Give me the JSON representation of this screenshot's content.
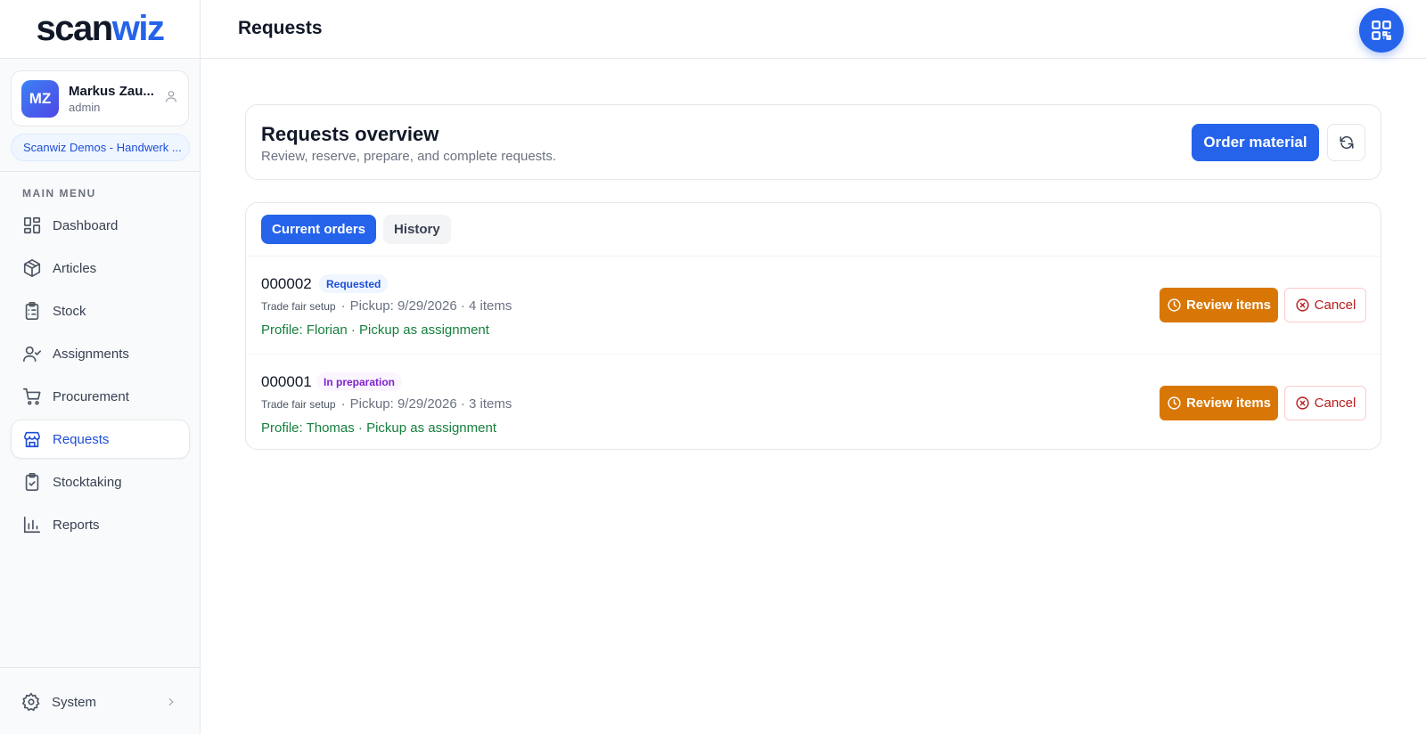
{
  "app": {
    "logo_scan": "scan",
    "logo_wiz": "wiz"
  },
  "user": {
    "initials": "MZ",
    "name": "Markus Zau...",
    "role": "admin",
    "organization": "Scanwiz Demos - Handwerk ..."
  },
  "sidebar": {
    "heading": "MAIN MENU",
    "items": [
      {
        "label": "Dashboard",
        "icon": "dashboard-icon"
      },
      {
        "label": "Articles",
        "icon": "package-icon"
      },
      {
        "label": "Stock",
        "icon": "clipboard-list-icon"
      },
      {
        "label": "Assignments",
        "icon": "user-check-icon"
      },
      {
        "label": "Procurement",
        "icon": "cart-icon"
      },
      {
        "label": "Requests",
        "icon": "store-icon",
        "active": true
      },
      {
        "label": "Stocktaking",
        "icon": "clipboard-check-icon"
      },
      {
        "label": "Reports",
        "icon": "bar-chart-icon"
      }
    ],
    "system_label": "System"
  },
  "header": {
    "title": "Requests"
  },
  "overview": {
    "title": "Requests overview",
    "subtitle": "Review, reserve, prepare, and complete requests.",
    "order_button": "Order material"
  },
  "tabs": [
    {
      "label": "Current orders",
      "active": true
    },
    {
      "label": "History",
      "active": false
    }
  ],
  "orders": [
    {
      "id": "000002",
      "status": "Requested",
      "tag": "Trade fair setup",
      "details": "Pickup: 9/29/2026 · 4 items",
      "profile": "Profile: Florian · Pickup as assignment",
      "review_label": "Review items",
      "cancel_label": "Cancel"
    },
    {
      "id": "000001",
      "status": "In preparation",
      "tag": "Trade fair setup",
      "details": "Pickup: 9/29/2026 · 3 items",
      "profile": "Profile: Thomas · Pickup as assignment",
      "review_label": "Review items",
      "cancel_label": "Cancel"
    }
  ],
  "colors": {
    "primary": "#2563eb",
    "warning": "#d97706",
    "danger": "#b91c1c",
    "success": "#15803d"
  }
}
